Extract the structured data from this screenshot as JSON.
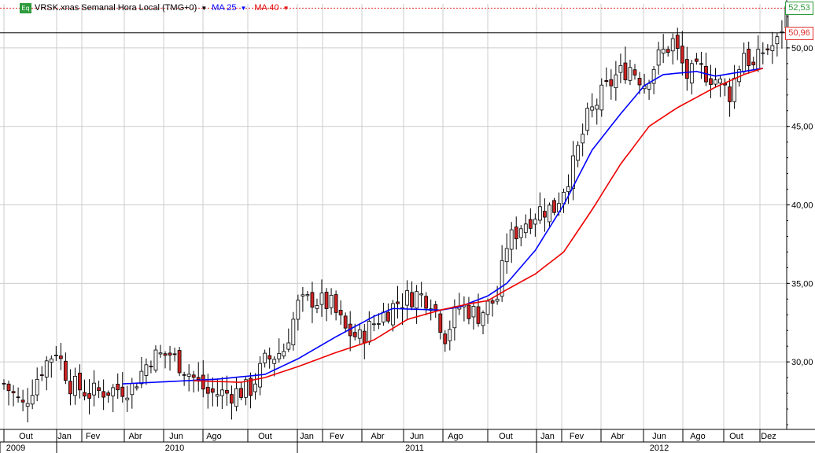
{
  "header": {
    "icon_text": "Eq",
    "symbol": "VRSK.xnas Semanal Hora Local (TMG+0)",
    "ma25_label": "MA 25",
    "ma40_label": "MA 40"
  },
  "colors": {
    "up": "#f4f4f4",
    "down": "#cc2222",
    "ma25": "#0000ff",
    "ma40": "#ee0000",
    "grid": "#cccccc",
    "last_price": "#2e9b3c",
    "ref_price": "#e03030"
  },
  "price_tags": {
    "last": "52,53",
    "ref": "50,96"
  },
  "chart_data": {
    "type": "candlestick",
    "title": "VRSK.xnas Semanal Hora Local (TMG+0)",
    "y_ticks": [
      "30,00",
      "35,00",
      "40,00",
      "45,00",
      "50,00"
    ],
    "ylim": [
      25.7,
      52.8
    ],
    "grid": true,
    "x_month_labels": [
      "Out",
      "Jan",
      "Fev",
      "Abr",
      "Jun",
      "Ago",
      "Out",
      "Jan",
      "Fev",
      "Abr",
      "Jun",
      "Ago",
      "Out",
      "Jan",
      "Fev",
      "Abr",
      "Jun",
      "Ago",
      "Out",
      "Dez"
    ],
    "x_year_labels": [
      "2009",
      "2010",
      "2011",
      "2012"
    ],
    "last_price": 52.53,
    "ref_price": 50.96,
    "period": "weekly",
    "anchors": [
      [
        0,
        28.6
      ],
      [
        4,
        27.2
      ],
      [
        8,
        29.6
      ],
      [
        11,
        30.8
      ],
      [
        14,
        28.6
      ],
      [
        18,
        28.0
      ],
      [
        22,
        28.2
      ],
      [
        27,
        28.4
      ],
      [
        31,
        30.3
      ],
      [
        35,
        30.5
      ],
      [
        39,
        29.3
      ],
      [
        43,
        28.0
      ],
      [
        48,
        28.0
      ],
      [
        52,
        28.3
      ],
      [
        55,
        30.0
      ],
      [
        59,
        30.8
      ],
      [
        62,
        33.6
      ],
      [
        65,
        34.0
      ],
      [
        69,
        33.6
      ],
      [
        72,
        32.0
      ],
      [
        75,
        31.5
      ],
      [
        79,
        32.8
      ],
      [
        83,
        33.8
      ],
      [
        87,
        34.3
      ],
      [
        90,
        34.0
      ],
      [
        93,
        31.7
      ],
      [
        96,
        33.6
      ],
      [
        100,
        33.0
      ],
      [
        104,
        34.1
      ],
      [
        106,
        37.5
      ],
      [
        109,
        38.7
      ],
      [
        113,
        39.7
      ],
      [
        116,
        39.8
      ],
      [
        120,
        42.5
      ],
      [
        123,
        45.5
      ],
      [
        126,
        47.0
      ],
      [
        129,
        48.2
      ],
      [
        132,
        48.8
      ],
      [
        135,
        47.8
      ],
      [
        138,
        49.4
      ],
      [
        141,
        50.4
      ],
      [
        144,
        48.2
      ],
      [
        147,
        48.6
      ],
      [
        150,
        48.0
      ],
      [
        153,
        47.1
      ],
      [
        156,
        49.8
      ],
      [
        158,
        48.7
      ],
      [
        160,
        49.8
      ],
      [
        163,
        50.3
      ],
      [
        165,
        52.4
      ]
    ],
    "series": [
      {
        "name": "MA 25",
        "anchors": [
          [
            25,
            28.6
          ],
          [
            45,
            28.9
          ],
          [
            55,
            29.2
          ],
          [
            62,
            30.2
          ],
          [
            70,
            31.6
          ],
          [
            78,
            32.9
          ],
          [
            82,
            33.4
          ],
          [
            92,
            33.3
          ],
          [
            96,
            33.5
          ],
          [
            102,
            34.2
          ],
          [
            106,
            35.0
          ],
          [
            112,
            37.1
          ],
          [
            118,
            40.0
          ],
          [
            124,
            43.5
          ],
          [
            130,
            45.8
          ],
          [
            135,
            47.6
          ],
          [
            139,
            48.3
          ],
          [
            146,
            48.5
          ],
          [
            150,
            48.2
          ],
          [
            156,
            48.5
          ],
          [
            160,
            48.7
          ]
        ]
      },
      {
        "name": "MA 40",
        "anchors": [
          [
            40,
            28.8
          ],
          [
            50,
            28.7
          ],
          [
            55,
            29.0
          ],
          [
            62,
            29.7
          ],
          [
            70,
            30.6
          ],
          [
            78,
            31.4
          ],
          [
            85,
            32.7
          ],
          [
            92,
            33.3
          ],
          [
            98,
            33.7
          ],
          [
            102,
            33.9
          ],
          [
            106,
            34.6
          ],
          [
            112,
            35.6
          ],
          [
            118,
            37.0
          ],
          [
            124,
            39.7
          ],
          [
            130,
            42.6
          ],
          [
            136,
            45.0
          ],
          [
            142,
            46.2
          ],
          [
            150,
            47.5
          ],
          [
            156,
            48.3
          ],
          [
            160,
            48.7
          ]
        ]
      }
    ]
  }
}
